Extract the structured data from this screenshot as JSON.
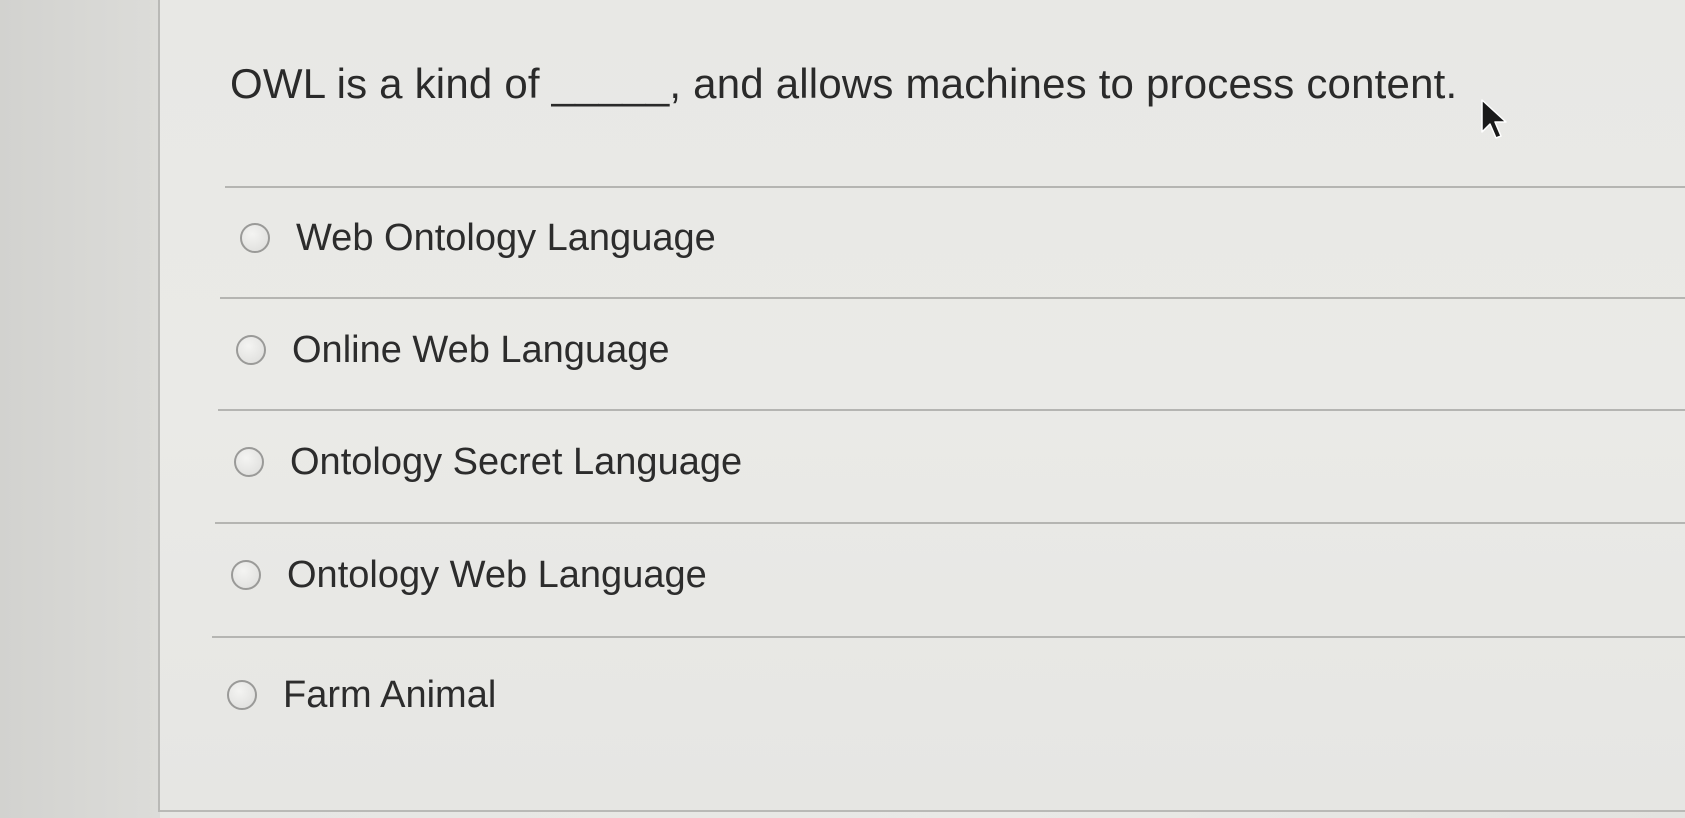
{
  "question": {
    "text": "OWL is a kind of _____, and allows machines to process content."
  },
  "options": [
    {
      "label": "Web Ontology Language"
    },
    {
      "label": "Online Web Language"
    },
    {
      "label": "Ontology Secret Language"
    },
    {
      "label": "Ontology Web Language"
    },
    {
      "label": "Farm Animal"
    }
  ],
  "icons": {
    "cursor": "mouse-pointer-icon",
    "radio": "radio-button-unchecked"
  },
  "colors": {
    "text": "#2a2a2a",
    "divider": "#b5b5b2",
    "background": "#e8e8e5"
  }
}
